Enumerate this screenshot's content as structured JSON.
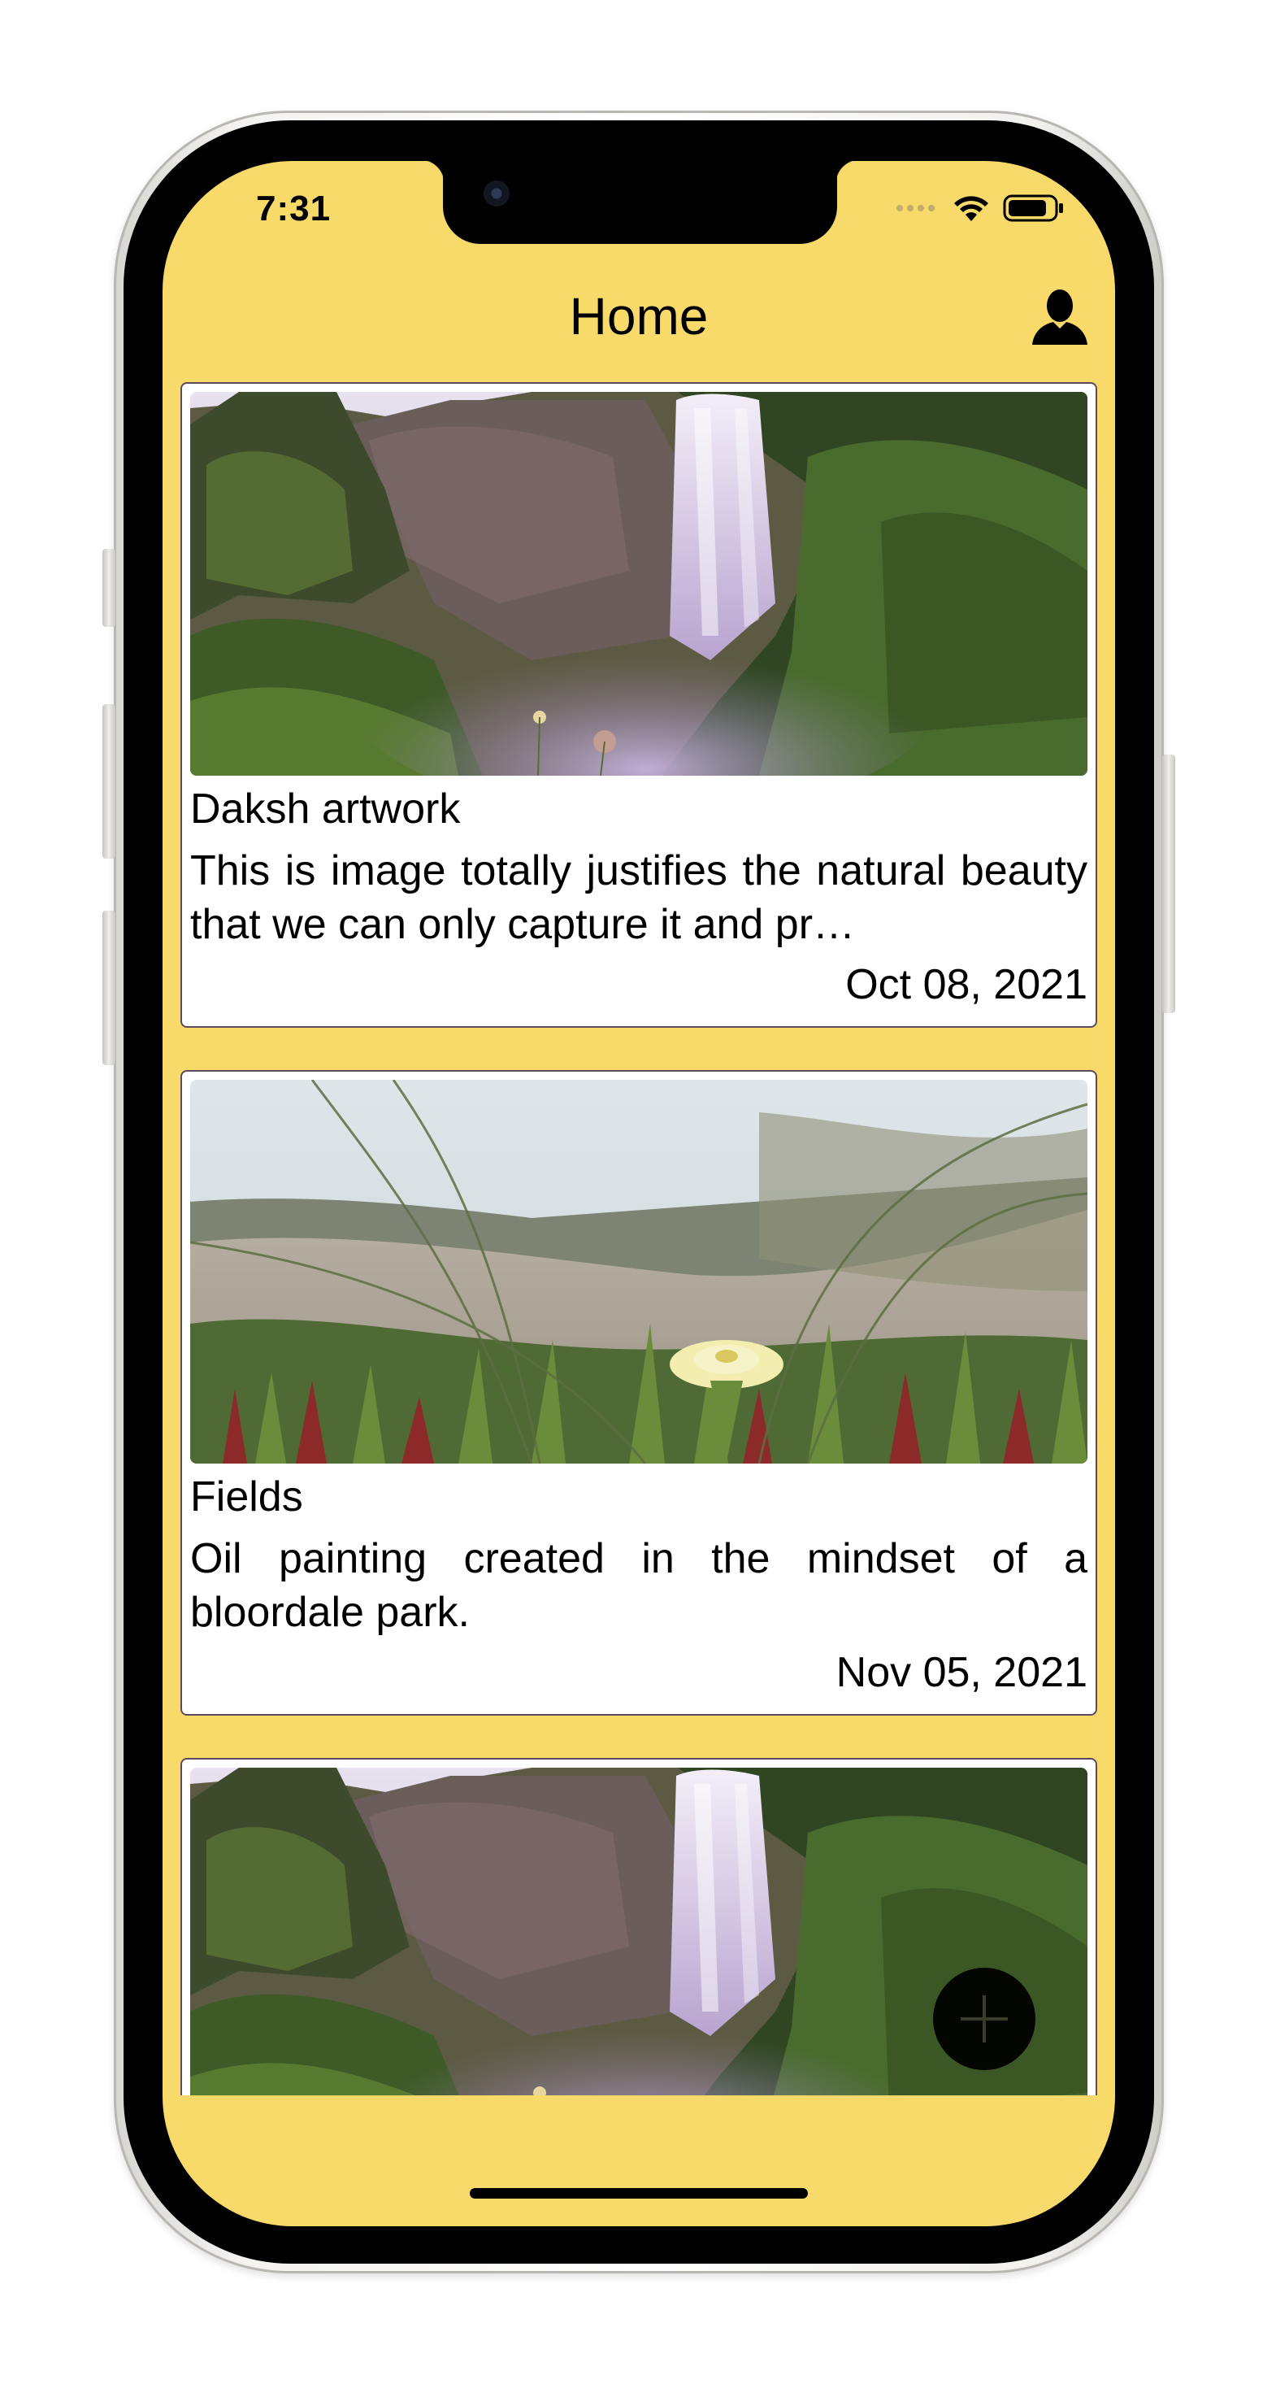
{
  "status_bar": {
    "time": "7:31",
    "icons": [
      "cellular-signal-icon",
      "wifi-icon",
      "battery-icon"
    ]
  },
  "header": {
    "title": "Home",
    "profile_icon": "person-icon"
  },
  "posts": [
    {
      "title": "Daksh artwork",
      "description": "This is image totally justifies the natural beauty that we can only capture it and pr…",
      "date": "Oct 08, 2021",
      "image": "waterfall-image"
    },
    {
      "title": "Fields",
      "description": "Oil painting created in the mindset of a bloordale park.",
      "date": "Nov 05, 2021",
      "image": "flower-field-image"
    },
    {
      "title": "",
      "description": "",
      "date": "",
      "image": "waterfall-image"
    }
  ],
  "fab": {
    "icon": "plus-icon"
  },
  "colors": {
    "background": "#f7da6a",
    "card_border": "#5a4a5c",
    "card_background": "#ffffff",
    "text": "#000000"
  }
}
